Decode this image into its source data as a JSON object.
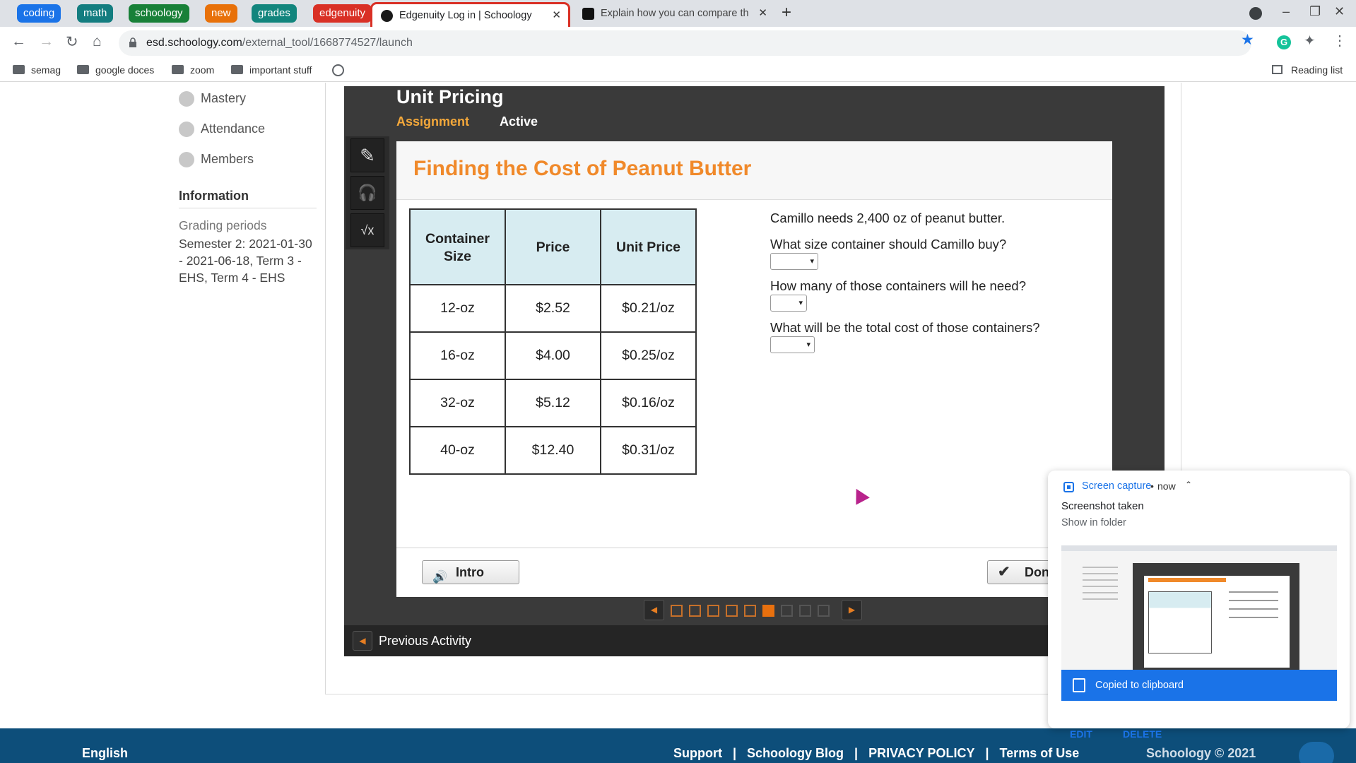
{
  "browser": {
    "tab_groups": [
      {
        "label": "coding",
        "color": "#1a73e8"
      },
      {
        "label": "math",
        "color": "#137d80"
      },
      {
        "label": "schoology",
        "color": "#188038"
      },
      {
        "label": "new",
        "color": "#e8710a"
      },
      {
        "label": "grades",
        "color": "#12857d"
      },
      {
        "label": "edgenuity",
        "color": "#d93025"
      }
    ],
    "tabs": [
      {
        "title": "Edgenuity Log in | Schoology",
        "active": true,
        "close": "✕"
      },
      {
        "title": "Explain how you can compare th",
        "active": false,
        "close": "✕"
      }
    ],
    "new_tab": "+",
    "window_controls": {
      "minimize": "–",
      "restore": "❐",
      "close": "✕"
    },
    "nav": {
      "back": "←",
      "forward": "→",
      "reload": "↻",
      "home": "⌂"
    },
    "url_host": "esd.schoology.com",
    "url_path": "/external_tool/1668774527/launch",
    "star": "★",
    "grammarly": "G",
    "extensions": "✦",
    "menu": "⋮",
    "bookmarks": [
      "semag",
      "google doces",
      "zoom",
      "important stuff"
    ],
    "reading_list": "Reading list"
  },
  "sidebar": {
    "items": [
      {
        "label": "Mastery"
      },
      {
        "label": "Attendance"
      },
      {
        "label": "Members"
      }
    ],
    "information_heading": "Information",
    "grading_label": "Grading periods",
    "grading_value": "Semester 2: 2021-01-30 - 2021-06-18, Term 3 - EHS, Term 4 - EHS"
  },
  "player": {
    "unit_title": "Unit Pricing",
    "assignment_label": "Assignment",
    "status_label": "Active",
    "tools": [
      "✎",
      "🎧",
      "√x"
    ],
    "activity_title": "Finding the Cost of Peanut Butter",
    "table": {
      "headers": [
        "Container Size",
        "Price",
        "Unit Price"
      ],
      "rows": [
        [
          "12-oz",
          "$2.52",
          "$0.21/oz"
        ],
        [
          "16-oz",
          "$4.00",
          "$0.25/oz"
        ],
        [
          "32-oz",
          "$5.12",
          "$0.16/oz"
        ],
        [
          "40-oz",
          "$12.40",
          "$0.31/oz"
        ]
      ]
    },
    "prompt": "Camillo needs 2,400 oz of peanut butter.",
    "questions": [
      {
        "text": "What size container should Camillo buy?",
        "selected": ""
      },
      {
        "text": "How many of those containers will he need?",
        "selected": ""
      },
      {
        "text": "What will be the total cost of those containers?",
        "selected": ""
      }
    ],
    "select_caret": "▾",
    "intro_label": "Intro",
    "speaker_icon": "🔊",
    "done_label": "Done",
    "check_icon": "✔",
    "pager": {
      "prev": "◀",
      "next": "▶",
      "total": 9,
      "current": 6
    },
    "previous_activity_label": "Previous Activity",
    "prev_arrow": "◀"
  },
  "footer": {
    "language": "English",
    "links": [
      "Support",
      "Schoology Blog",
      "PRIVACY POLICY",
      "Terms of Use"
    ],
    "separator": "|",
    "copyright": "Schoology © 2021"
  },
  "notification": {
    "app": "Screen capture",
    "dot": "•",
    "time": "now",
    "chevron": "⌃",
    "title": "Screenshot taken",
    "subtitle": "Show in folder",
    "clipboard": "Copied to clipboard",
    "edit": "EDIT",
    "delete": "DELETE"
  },
  "colors": {
    "accent_orange": "#f0892a",
    "player_bg": "#3a3a3a",
    "footer_bg": "#0d4e7a",
    "link_blue": "#1a73e8"
  }
}
